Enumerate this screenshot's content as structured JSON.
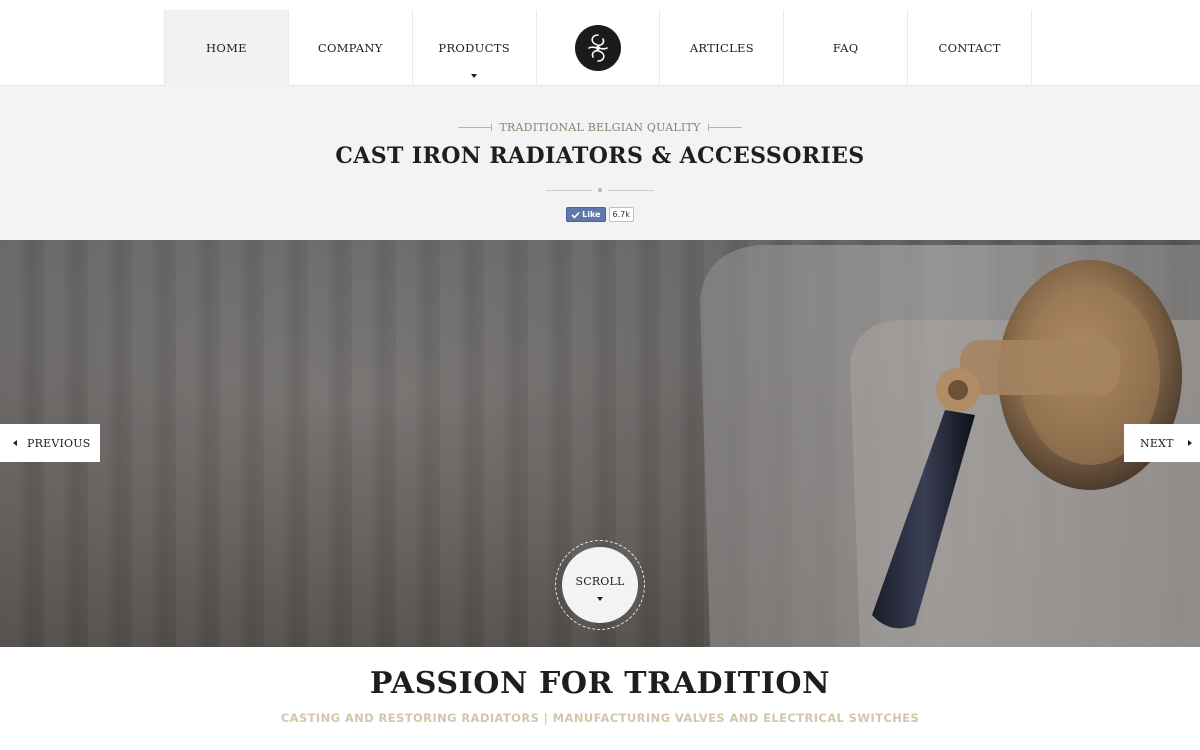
{
  "nav": {
    "items": [
      {
        "label": "HOME",
        "active": true
      },
      {
        "label": "COMPANY"
      },
      {
        "label": "PRODUCTS",
        "has_dropdown": true
      },
      {
        "label": "ARTICLES"
      },
      {
        "label": "FAQ"
      },
      {
        "label": "CONTACT"
      }
    ],
    "logo_icon": "monogram-logo-icon"
  },
  "hero": {
    "tagline": "TRADITIONAL BELGIAN QUALITY",
    "title": "CAST IRON RADIATORS & ACCESSORIES",
    "like": {
      "label": "Like",
      "count": "6.7k"
    }
  },
  "slider": {
    "prev_label": "PREVIOUS",
    "next_label": "NEXT",
    "scroll_label": "SCROLL",
    "image_subject": "radiator valve close-up"
  },
  "section": {
    "title": "PASSION FOR TRADITION",
    "subtitle": "CASTING AND RESTORING RADIATORS | MANUFACTURING VALVES AND ELECTRICAL SWITCHES"
  },
  "colors": {
    "band_bg": "#f4f3f3",
    "text": "#1e1e1e",
    "accent_gold": "#d3c7a9",
    "tagline": "#8a7f6c",
    "facebook": "#5f78ab"
  }
}
